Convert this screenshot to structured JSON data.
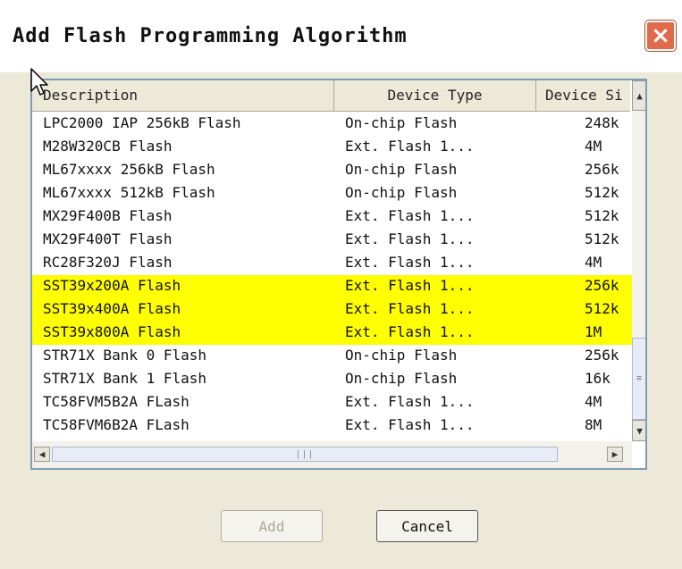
{
  "window": {
    "title": "Add Flash Programming Algorithm",
    "close_glyph": "×"
  },
  "columns": [
    "Description",
    "Device Type",
    "Device Si"
  ],
  "rows": [
    {
      "description": "LPC2000 IAP 256kB Flash",
      "type": "On-chip Flash",
      "size": "248k",
      "highlighted": false
    },
    {
      "description": "M28W320CB Flash",
      "type": "Ext. Flash 1...",
      "size": "4M",
      "highlighted": false
    },
    {
      "description": "ML67xxxx 256kB Flash",
      "type": "On-chip Flash",
      "size": "256k",
      "highlighted": false
    },
    {
      "description": "ML67xxxx 512kB Flash",
      "type": "On-chip Flash",
      "size": "512k",
      "highlighted": false
    },
    {
      "description": "MX29F400B Flash",
      "type": "Ext. Flash 1...",
      "size": "512k",
      "highlighted": false
    },
    {
      "description": "MX29F400T Flash",
      "type": "Ext. Flash 1...",
      "size": "512k",
      "highlighted": false
    },
    {
      "description": "RC28F320J Flash",
      "type": "Ext. Flash 1...",
      "size": "4M",
      "highlighted": false
    },
    {
      "description": "SST39x200A Flash",
      "type": "Ext. Flash 1...",
      "size": "256k",
      "highlighted": true
    },
    {
      "description": "SST39x400A Flash",
      "type": "Ext. Flash 1...",
      "size": "512k",
      "highlighted": true
    },
    {
      "description": "SST39x800A Flash",
      "type": "Ext. Flash 1...",
      "size": "1M",
      "highlighted": true
    },
    {
      "description": "STR71X Bank 0 Flash",
      "type": "On-chip Flash",
      "size": "256k",
      "highlighted": false
    },
    {
      "description": "STR71X Bank 1 Flash",
      "type": "On-chip Flash",
      "size": "16k",
      "highlighted": false
    },
    {
      "description": "TC58FVM5B2A FLash",
      "type": "Ext. Flash 1...",
      "size": "4M",
      "highlighted": false
    },
    {
      "description": "TC58FVM6B2A FLash",
      "type": "Ext. Flash 1...",
      "size": "8M",
      "highlighted": false
    }
  ],
  "buttons": {
    "add": "Add",
    "cancel": "Cancel"
  },
  "icons": {
    "close": "close-icon",
    "up": "chevron-up-icon",
    "down": "chevron-down-icon",
    "left": "chevron-left-icon",
    "right": "chevron-right-icon"
  },
  "colors": {
    "highlight": "#ffff00",
    "close": "#e06a4c",
    "dialog": "#ece9d8"
  }
}
